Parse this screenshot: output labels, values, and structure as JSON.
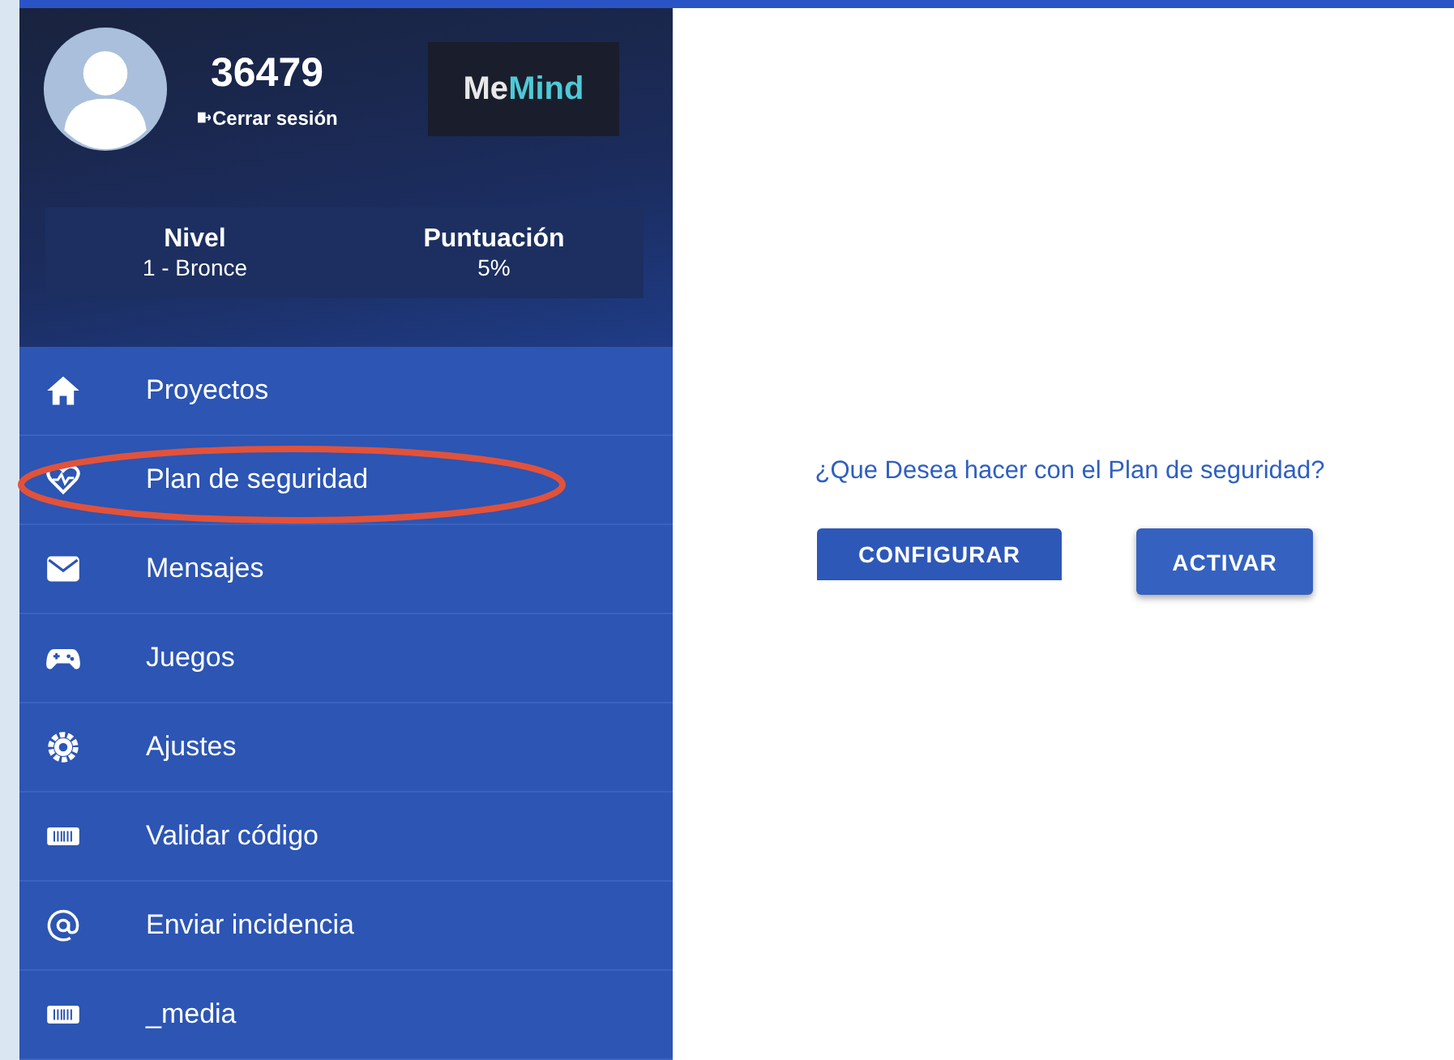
{
  "profile": {
    "user_id": "36479",
    "logout": "Cerrar sesión",
    "logo": {
      "first": "Me",
      "second": "Mind"
    }
  },
  "stats": [
    {
      "label": "Nivel",
      "value": "1 - Bronce"
    },
    {
      "label": "Puntuación",
      "value": "5%"
    }
  ],
  "menu": [
    {
      "label": "Proyectos",
      "kind": "home",
      "circled": false
    },
    {
      "label": "Plan de seguridad",
      "kind": "heart",
      "circled": true
    },
    {
      "label": "Mensajes",
      "kind": "mail",
      "circled": false
    },
    {
      "label": "Juegos",
      "kind": "gamepad",
      "circled": false
    },
    {
      "label": "Ajustes",
      "kind": "gear",
      "circled": false
    },
    {
      "label": "Validar código",
      "kind": "barcode",
      "circled": false
    },
    {
      "label": "Enviar incidencia",
      "kind": "at",
      "circled": false
    },
    {
      "label": "_media",
      "kind": "barcode",
      "circled": false
    }
  ],
  "main": {
    "question": "¿Que Desea hacer con el Plan de seguridad?",
    "buttons": [
      {
        "label": "CONFIGURAR",
        "kind": "flat"
      },
      {
        "label": "ACTIVAR",
        "kind": "raised"
      }
    ]
  }
}
